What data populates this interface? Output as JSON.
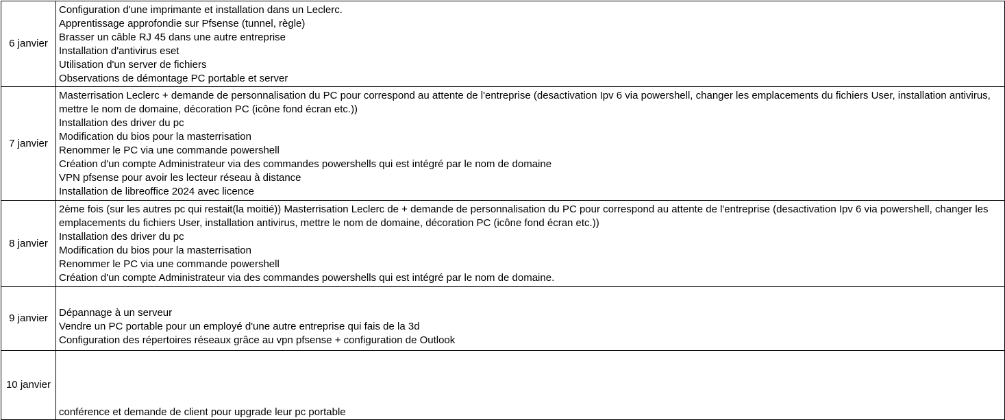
{
  "entries": [
    {
      "date": "6 janvier",
      "tasks": [
        "Configuration d'une imprimante et installation dans un Leclerc.",
        "Apprentissage approfondie sur Pfsense (tunnel, règle)",
        "Brasser un câble RJ 45 dans une autre entreprise",
        "Installation d'antivirus eset",
        "Utilisation d'un server de fichiers",
        "Observations de démontage PC portable et server"
      ]
    },
    {
      "date": "7 janvier",
      "tasks": [
        "Masterrisation Leclerc + demande de personnalisation du PC pour correspond au attente de l'entreprise (desactivation Ipv 6 via powershell, changer les emplacements du fichiers User, installation antivirus, mettre le nom de domaine, décoration PC (icône fond écran etc.))",
        "Installation des driver du pc",
        "Modification du bios pour la masterrisation",
        "Renommer le PC via une commande powershell",
        "Création d'un compte Administrateur via des commandes powershells qui est intégré par le nom de domaine",
        "VPN pfsense pour avoir les lecteur réseau à distance",
        "Installation de libreoffice 2024 avec licence"
      ]
    },
    {
      "date": "8 janvier",
      "tasks": [
        "2ème fois (sur les autres pc qui restait(la moitié)) Masterrisation Leclerc de + demande de personnalisation du PC pour correspond au attente de l'entreprise (desactivation Ipv 6 via powershell, changer les emplacements du fichiers User, installation antivirus, mettre le nom de domaine, décoration PC (icône fond écran etc.))",
        "Installation des driver du pc",
        "Modification du bios pour la masterrisation",
        "Renommer le PC via une commande powershell",
        "Création d'un compte Administrateur via des commandes powershells qui est intégré par le nom de domaine."
      ]
    },
    {
      "date": "9 janvier",
      "tasks": [
        "Dépannage à un serveur",
        "Vendre un PC portable pour un employé d'une autre entreprise qui fais de la 3d",
        "Configuration des répertoires réseaux grâce au vpn pfsense + configuration de Outlook"
      ]
    },
    {
      "date": "10 janvier",
      "tasks": [
        "conférence et demande de client pour upgrade leur pc portable"
      ]
    }
  ]
}
